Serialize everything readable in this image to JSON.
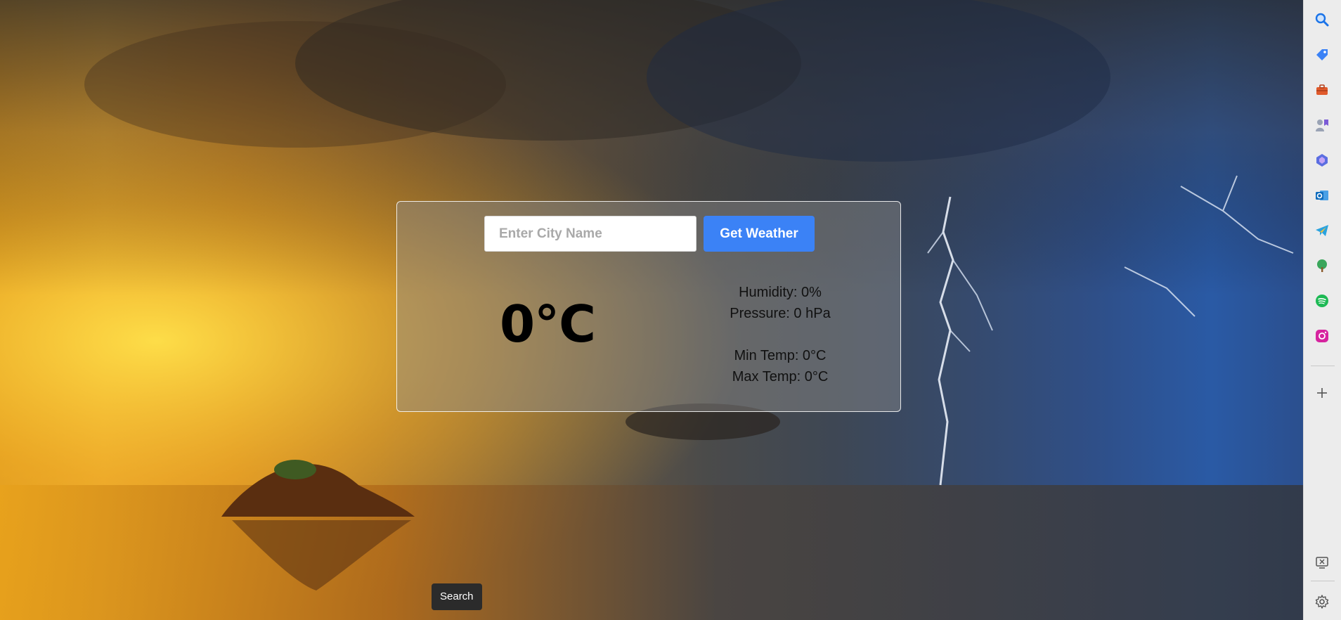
{
  "search": {
    "placeholder": "Enter City Name",
    "value": "",
    "button_label": "Get Weather"
  },
  "weather": {
    "temperature": "0°C",
    "humidity": "Humidity: 0%",
    "pressure": "Pressure: 0 hPa",
    "min_temp": "Min Temp: 0°C",
    "max_temp": "Max Temp: 0°C"
  },
  "tooltip": {
    "text": "Search"
  },
  "sidebar": {
    "items": [
      {
        "icon": "search-icon",
        "color": "#1a73e8"
      },
      {
        "icon": "shopping-tag-icon",
        "color": "#3b82f6"
      },
      {
        "icon": "tools-icon",
        "color": "#e05a2b"
      },
      {
        "icon": "games-icon",
        "color": "#7b5bd6"
      },
      {
        "icon": "copilot-icon",
        "color": "#5b6ee1"
      },
      {
        "icon": "outlook-icon",
        "color": "#0f6cbd"
      },
      {
        "icon": "telegram-icon",
        "color": "#2aa3df"
      },
      {
        "icon": "tree-icon",
        "color": "#3aa65b"
      },
      {
        "icon": "spotify-icon",
        "color": "#1db954"
      },
      {
        "icon": "instagram-icon",
        "color": "#d6249f"
      },
      {
        "icon": "add-icon",
        "color": "#555555"
      },
      {
        "icon": "screenshot-icon",
        "color": "#555555"
      },
      {
        "icon": "settings-icon",
        "color": "#555555"
      }
    ]
  }
}
